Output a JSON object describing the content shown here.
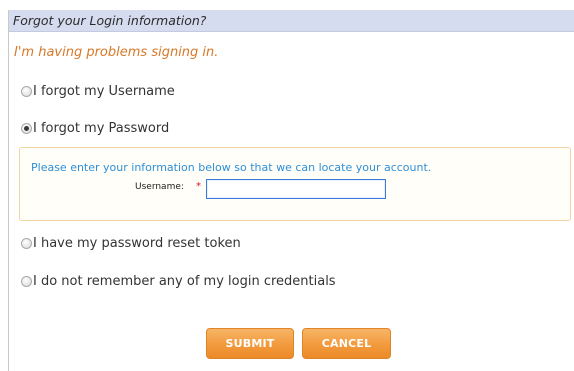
{
  "panel": {
    "title": "Forgot your Login information?",
    "subtitle": "I'm having problems signing in."
  },
  "options": [
    {
      "label": "I forgot my Username",
      "selected": false
    },
    {
      "label": "I forgot my Password",
      "selected": true
    },
    {
      "label": "I have my password reset token",
      "selected": false
    },
    {
      "label": "I do not remember any of my login credentials",
      "selected": false
    }
  ],
  "info_box": {
    "instructions": "Please enter your information below so that we can locate your account.",
    "username_label": "Username:",
    "required_marker": "*",
    "username_value": ""
  },
  "buttons": {
    "submit": "SUBMIT",
    "cancel": "CANCEL"
  },
  "colors": {
    "header_bg": "#d5dcef",
    "subtitle": "#d8792a",
    "instructions": "#2f8fd6",
    "button": "#f29a3d",
    "box_border": "#f3d39f",
    "required": "#d0112b"
  }
}
